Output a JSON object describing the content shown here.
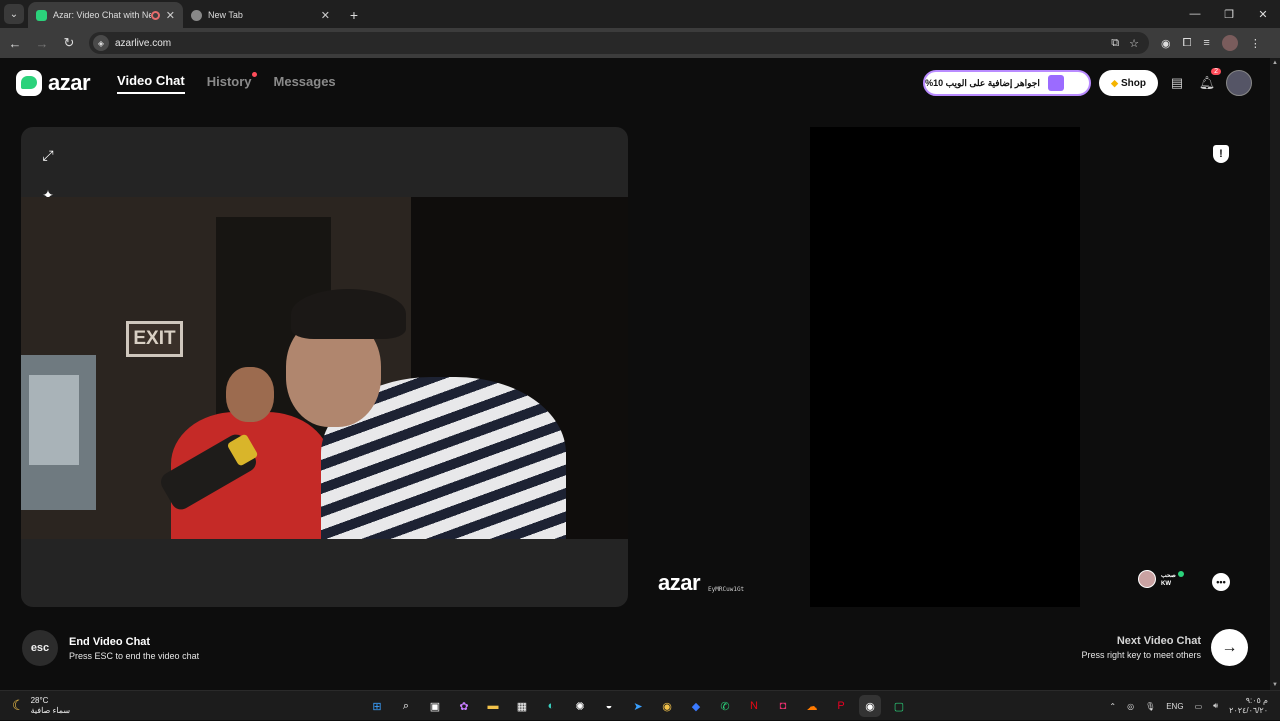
{
  "browser": {
    "tabs": [
      {
        "title": "Azar: Video Chat with New",
        "active": true,
        "favicon_color": "#2bd27b"
      },
      {
        "title": "New Tab",
        "active": false
      }
    ],
    "url": "azarlive.com"
  },
  "header": {
    "logo_text": "azar",
    "nav": [
      {
        "label": "Video Chat",
        "active": true
      },
      {
        "label": "History",
        "has_dot": true
      },
      {
        "label": "Messages"
      }
    ],
    "promo_text": "اجواهر إضافية على الويب 10%",
    "shop_label": "Shop",
    "notification_count": "2"
  },
  "video": {
    "local_scene_text": "EXIT",
    "watermark_logo": "azar",
    "watermark_id": "EyMRCuw1Gt",
    "peer": {
      "name": "صحب",
      "country": "KW"
    }
  },
  "controls": {
    "esc_key": "esc",
    "end_title": "End Video Chat",
    "end_hint": "Press ESC to end the video chat",
    "next_title": "Next Video Chat",
    "next_hint": "Press right key to meet others"
  },
  "taskbar": {
    "temperature": "28°C",
    "weather_desc": "سماء صافية",
    "language": "ENG",
    "time": "م ٩:٠٥",
    "date": "٢٠٢٤/٠٦/٢٠"
  },
  "colors": {
    "brand": "#2bd27b",
    "background": "#0d0d0d",
    "alert": "#ff4d5a"
  }
}
